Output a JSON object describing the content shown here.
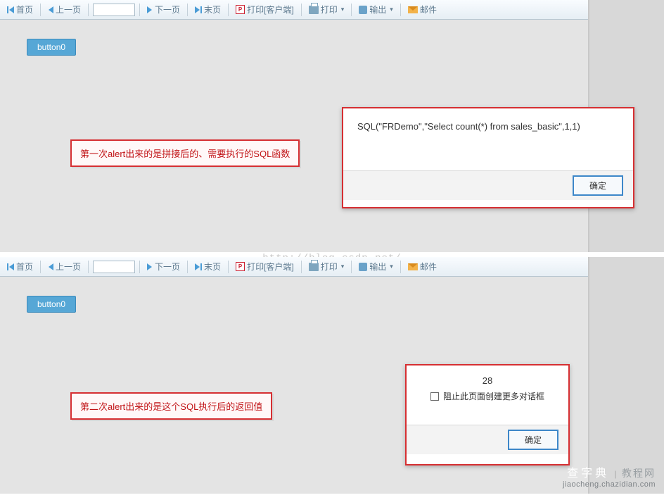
{
  "toolbar": {
    "first": "首页",
    "prev": "上一页",
    "next": "下一页",
    "last": "末页",
    "print_client": "打印[客户端]",
    "print": "打印",
    "export": "输出",
    "mail": "邮件",
    "page_value": ""
  },
  "button0_label": "button0",
  "screens": {
    "first": {
      "callout": "第一次alert出来的是拼接后的、需要执行的SQL函数",
      "alert": {
        "message": "SQL(\"FRDemo\",\"Select count(*) from sales_basic\",1,1)",
        "ok": "确定"
      }
    },
    "second": {
      "callout": "第二次alert出来的是这个SQL执行后的返回值",
      "alert": {
        "value": "28",
        "suppress": "阻止此页面创建更多对话框",
        "ok": "确定"
      }
    }
  },
  "watermark": {
    "url": "http://blog.csdn.net/",
    "brand_main": "查字典",
    "brand_sub": "教程网",
    "brand_url": "jiaocheng.chazidian.com"
  }
}
